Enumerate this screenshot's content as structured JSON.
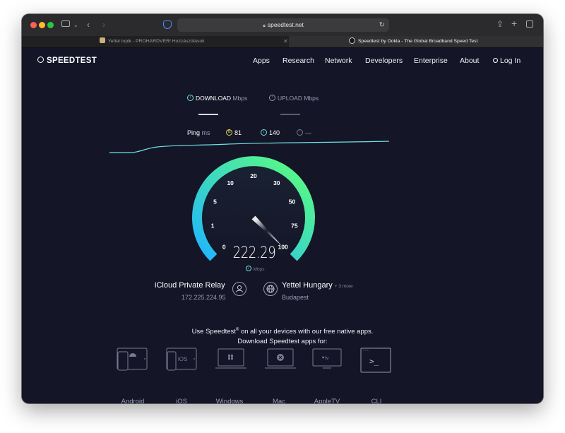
{
  "browser": {
    "address": "speedtest.net",
    "tabs": [
      {
        "title": "Yettel topik - PROHARDVER! Hozzászólások",
        "active": false
      },
      {
        "title": "Speedtest by Ookla - The Global Broadband Speed Test",
        "active": true
      }
    ],
    "shield_color": "#4d8dff"
  },
  "header": {
    "logo": "SPEEDTEST",
    "nav": [
      "Apps",
      "Research",
      "Network",
      "Developers",
      "Enterprise",
      "About"
    ],
    "login": "Log In"
  },
  "test_tabs": {
    "download_label": "DOWNLOAD",
    "download_unit": "Mbps",
    "upload_label": "UPLOAD",
    "upload_unit": "Mbps"
  },
  "ping": {
    "label": "Ping",
    "unit": "ms",
    "idle": "81",
    "download": "140",
    "upload": "—"
  },
  "gauge": {
    "ticks": [
      "0",
      "1",
      "5",
      "10",
      "20",
      "30",
      "50",
      "75",
      "100"
    ],
    "needle_value": "100",
    "speed": "222.29",
    "unit": "Mbps",
    "gradient_start": "#1fb5ff",
    "gradient_end": "#5dff7a"
  },
  "connection": {
    "client_name": "iCloud Private Relay",
    "client_ip": "172.225.224.95",
    "server_name": "Yettel Hungary",
    "server_more": "+ 3 more",
    "server_location": "Budapest"
  },
  "promo": {
    "line1_before": "Use Speedtest",
    "line1_after": " on all your devices with our free native apps.",
    "line2": "Download Speedtest apps for:",
    "reg": "®"
  },
  "apps": [
    "Android",
    "iOS",
    "Windows",
    "Mac",
    "AppleTV",
    "CLI"
  ],
  "app_icon_text": {
    "ios": "iOS",
    "appletv": "tv",
    "cli": ">_"
  },
  "colors": {
    "background": "#141527",
    "accent": "#6fe3e0",
    "idle_ping": "#e8d45a"
  }
}
